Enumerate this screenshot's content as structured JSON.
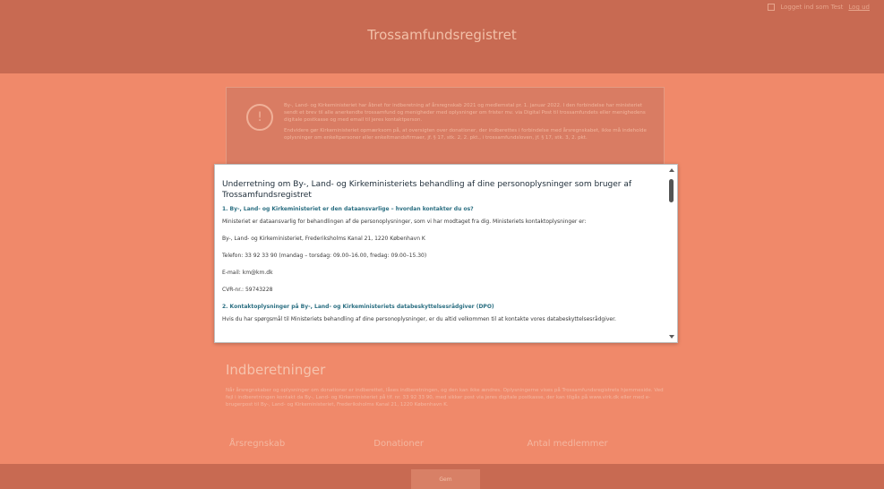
{
  "header": {
    "title": "Trossamfundsregistret",
    "login_text": "Logget ind som Test",
    "logout_label": "Log ud"
  },
  "alert": {
    "icon": "!",
    "para1": "By-, Land- og Kirkeministeriet har åbnet for indberetning af årsregnskab 2021 og medlemstal pr. 1. januar 2022. I den forbindelse har ministeriet sendt et brev til alle anerkendte trossamfund og menigheder med oplysninger om frister mv. via Digital Post til trossamfundets eller menighedens digitale postkasse og med email til jeres kontaktperson.",
    "para2": "Endvidere gør Kirkeministeriet opmærksom på, at oversigten over donationer, der indberettes i forbindelse med årsregnskabet, ikke må indeholde oplysninger om enkeltpersoner eller enkeltmandsfirmaer, jf. § 17, stk. 2, 2. pkt., i trossamfundsloven, jf. § 17, stk. 3, 2. pkt."
  },
  "modal": {
    "title": "Underretning om By-, Land- og Kirkeministeriets behandling af dine personoplysninger som bruger af Trossamfundsregistret",
    "section1_heading": "1. By-, Land- og Kirkeministeriet er den dataansvarlige – hvordan kontakter du os?",
    "section1_intro": "Ministeriet er dataansvarlig for behandlingen af de personoplysninger, som vi har modtaget fra dig. Ministeriets kontaktoplysninger er:",
    "address": "By-, Land- og Kirkeministeriet, Frederiksholms Kanal 21, 1220 København K",
    "phone": "Telefon: 33 92 33 90 (mandag – torsdag: 09.00–16.00, fredag: 09.00–15.30)",
    "email": "E-mail: km@km.dk",
    "cvr": "CVR-nr.: 59743228",
    "section2_heading": "2. Kontaktoplysninger på By-, Land- og Kirkeministeriets databeskyttelsesrådgiver (DPO)",
    "section2_text": "Hvis du har spørgsmål til Ministeriets behandling af dine personoplysninger, er du altid velkommen til at kontakte vores databeskyttelsesrådgiver."
  },
  "content": {
    "heading": "Indberetninger",
    "paragraph": "Når årsregnskaber og oplysninger om donationer er indberettet, låses indberetningen, og den kan ikke ændres. Oplysningerne vises på Trossamfundsregistrets hjemmeside. Ved fejl i indberetningen kontakt da By-, Land- og Kirkeministeriet på tlf. nr. 33 92 33 90, med sikker post via jeres digitale postkasse, der kan tilgås på www.virk.dk eller med e-brugerpost til By-, Land- og Kirkeministeriet, Frederiksholms Kanal 21, 1220 København K.",
    "col1": "Årsregnskab",
    "col2": "Donationer",
    "col3": "Antal medlemmer"
  },
  "footer": {
    "button_label": "Gem"
  }
}
